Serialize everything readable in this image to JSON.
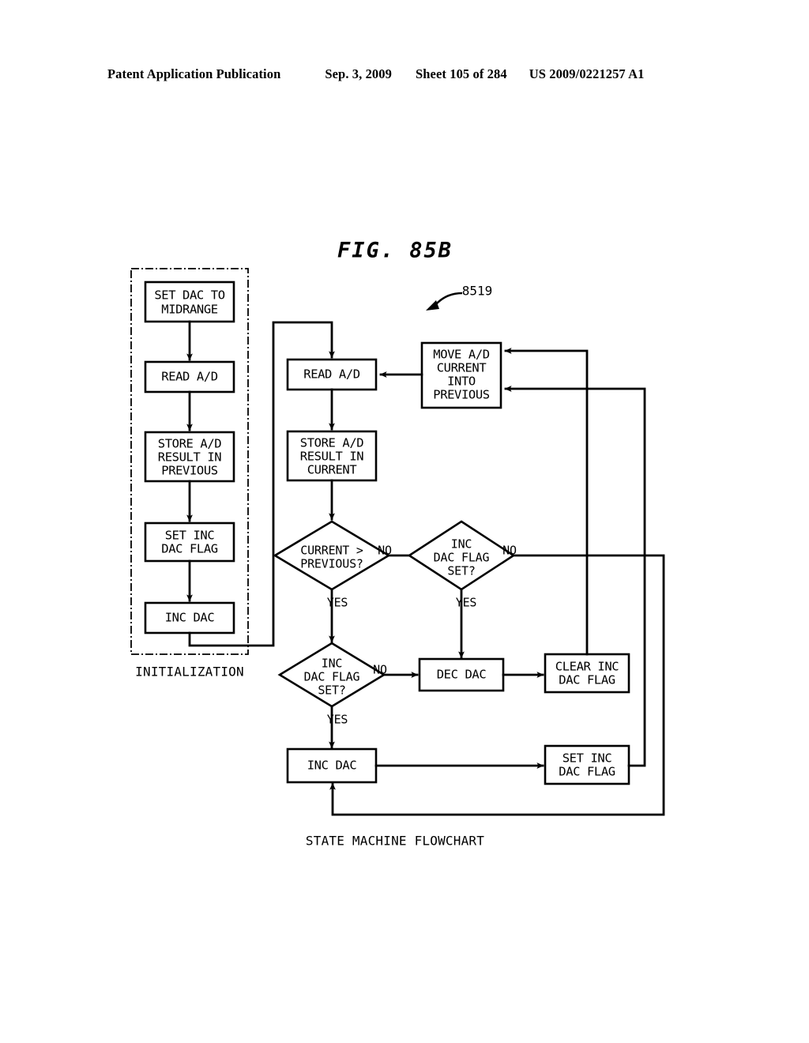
{
  "header": {
    "publication": "Patent Application Publication",
    "date": "Sep. 3, 2009",
    "sheet": "Sheet 105 of 284",
    "document_number": "US 2009/0221257 A1"
  },
  "figure": {
    "title": "FIG. 85B",
    "reference_numeral": "8519",
    "caption": "STATE MACHINE FLOWCHART",
    "group_label": "INITIALIZATION"
  },
  "nodes": {
    "set_dac_midrange": "SET DAC TO\nMIDRANGE",
    "read_ad_init": "READ A/D",
    "store_ad_previous": "STORE A/D\nRESULT IN\nPREVIOUS",
    "set_inc_dac_flag_init": "SET INC\nDAC FLAG",
    "inc_dac_init": "INC DAC",
    "read_ad_loop": "READ A/D",
    "store_ad_current": "STORE A/D\nRESULT IN\nCURRENT",
    "move_ad": "MOVE A/D\nCURRENT\nINTO\nPREVIOUS",
    "dec_dac": "DEC DAC",
    "clear_inc_dac_flag": "CLEAR INC\nDAC FLAG",
    "inc_dac_loop": "INC DAC",
    "set_inc_dac_flag_loop": "SET INC\nDAC FLAG"
  },
  "decisions": {
    "current_gt_previous": "CURRENT >\nPREVIOUS?",
    "inc_dac_flag_set_top": "INC\nDAC FLAG\nSET?",
    "inc_dac_flag_set_bottom": "INC\nDAC FLAG\nSET?"
  },
  "branch_labels": {
    "d1_no": "NO",
    "d1_yes": "YES",
    "d2_no": "NO",
    "d2_yes": "YES",
    "d3_no": "NO",
    "d3_yes": "YES"
  },
  "node_lines": {
    "set_dac_midrange": [
      "SET DAC TO",
      "MIDRANGE"
    ],
    "read_ad_init": [
      "READ A/D"
    ],
    "store_ad_previous": [
      "STORE A/D",
      "RESULT IN",
      "PREVIOUS"
    ],
    "set_inc_dac_flag_init": [
      "SET INC",
      "DAC FLAG"
    ],
    "inc_dac_init": [
      "INC DAC"
    ],
    "read_ad_loop": [
      "READ A/D"
    ],
    "store_ad_current": [
      "STORE A/D",
      "RESULT IN",
      "CURRENT"
    ],
    "move_ad": [
      "MOVE A/D",
      "CURRENT",
      "INTO",
      "PREVIOUS"
    ],
    "dec_dac": [
      "DEC DAC"
    ],
    "clear_inc_dac_flag": [
      "CLEAR INC",
      "DAC FLAG"
    ],
    "inc_dac_loop": [
      "INC DAC"
    ],
    "set_inc_dac_flag_loop": [
      "SET INC",
      "DAC FLAG"
    ],
    "current_gt_previous": [
      "CURRENT >",
      "PREVIOUS?"
    ],
    "inc_dac_flag_set_top": [
      "INC",
      "DAC FLAG",
      "SET?"
    ],
    "inc_dac_flag_set_bottom": [
      "INC",
      "DAC FLAG",
      "SET?"
    ]
  },
  "colors": {
    "ink": "#000000",
    "paper": "#ffffff"
  }
}
